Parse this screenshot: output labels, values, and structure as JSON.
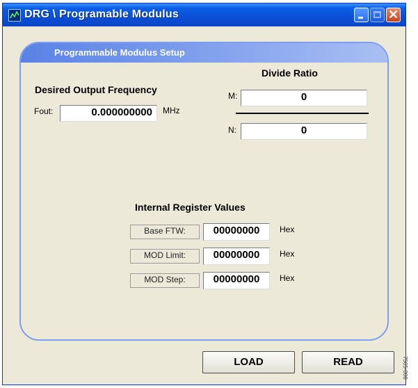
{
  "window": {
    "title": "DRG \\ Programable Modulus"
  },
  "panel": {
    "title": "Programmable Modulus Setup"
  },
  "output": {
    "heading": "Desired Output Frequency",
    "fout_label": "Fout:",
    "fout_value": "0.000000000",
    "unit": "MHz"
  },
  "divide": {
    "heading": "Divide Ratio",
    "m_label": "M:",
    "m_value": "0",
    "n_label": "N:",
    "n_value": "0"
  },
  "registers": {
    "heading": "Internal Register Values",
    "rows": [
      {
        "label": "Base FTW:",
        "value": "00000000",
        "unit": "Hex"
      },
      {
        "label": "MOD Limit:",
        "value": "00000000",
        "unit": "Hex"
      },
      {
        "label": "MOD Step:",
        "value": "00000000",
        "unit": "Hex"
      }
    ]
  },
  "buttons": {
    "load": "LOAD",
    "read": "READ"
  },
  "side_code": "7505-008"
}
